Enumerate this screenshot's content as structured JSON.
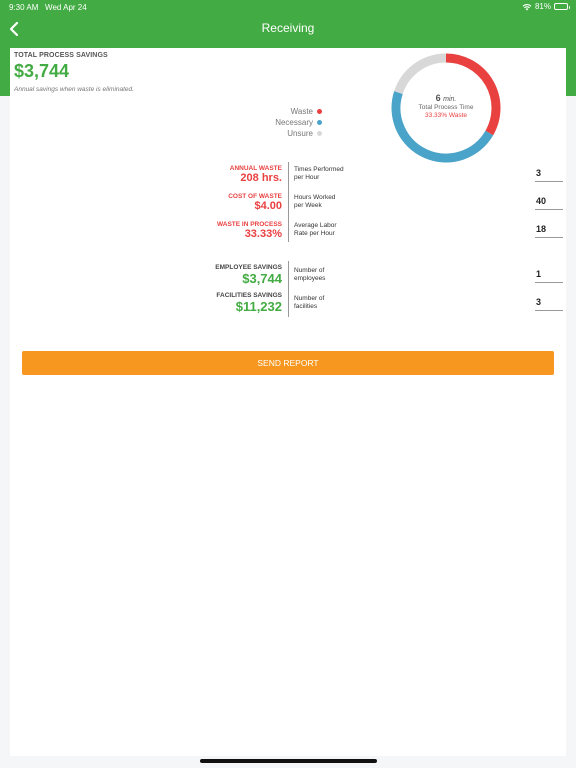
{
  "status_bar": {
    "time": "9:30 AM",
    "date": "Wed Apr 24",
    "battery": "81%",
    "battery_level": 0.81
  },
  "nav": {
    "title": "Receiving"
  },
  "summary": {
    "title": "TOTAL PROCESS SAVINGS",
    "value": "$3,744",
    "note": "Annual savings when waste is eliminated."
  },
  "legend": [
    {
      "label": "Waste",
      "color": "#e94040"
    },
    {
      "label": "Necessary",
      "color": "#4aa3c8"
    },
    {
      "label": "Unsure",
      "color": "#d8d8d8"
    }
  ],
  "chart_data": {
    "type": "pie",
    "categories": [
      "Waste",
      "Necessary",
      "Unsure"
    ],
    "values": [
      33.33,
      46.67,
      20
    ],
    "colors": [
      "#e94040",
      "#4aa3c8",
      "#d8d8d8"
    ],
    "center_value": "6",
    "center_unit": "min.",
    "center_label": "Total Process Time",
    "center_sub": "33.33% Waste"
  },
  "waste_stats": [
    {
      "label": "ANNUAL WASTE",
      "value": "208 hrs."
    },
    {
      "label": "COST OF WASTE",
      "value": "$4.00"
    },
    {
      "label": "WASTE IN PROCESS",
      "value": "33.33%"
    }
  ],
  "waste_inputs": [
    {
      "label_line1": "Times Performed",
      "label_line2": "per Hour",
      "value": "3"
    },
    {
      "label_line1": "Hours Worked",
      "label_line2": "per Week",
      "value": "40"
    },
    {
      "label_line1": "Average Labor",
      "label_line2": "Rate per Hour",
      "value": "18"
    }
  ],
  "savings_stats": [
    {
      "label": "EMPLOYEE SAVINGS",
      "value": "$3,744"
    },
    {
      "label": "FACILITIES SAVINGS",
      "value": "$11,232"
    }
  ],
  "savings_inputs": [
    {
      "label_line1": "Number of",
      "label_line2": "employees",
      "value": "1"
    },
    {
      "label_line1": "Number of",
      "label_line2": "facilities",
      "value": "3"
    }
  ],
  "actions": {
    "send_report": "SEND REPORT"
  }
}
